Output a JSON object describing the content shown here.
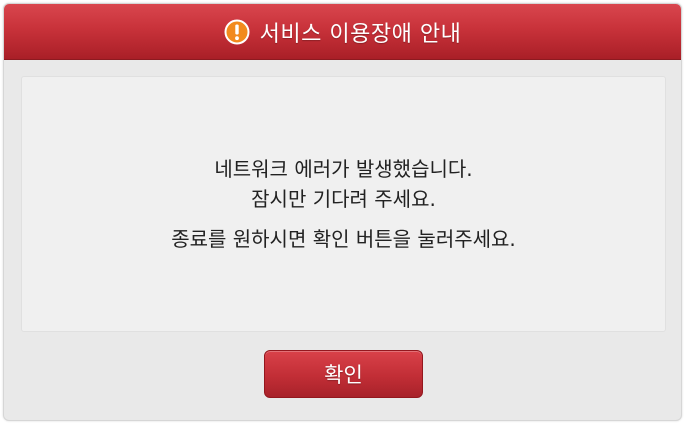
{
  "dialog": {
    "title": "서비스 이용장애 안내",
    "icon": "exclamation-circle-icon",
    "message": {
      "line1": "네트워크 에러가 발생했습니다.",
      "line2": "잠시만 기다려 주세요.",
      "line3": "종료를 원하시면 확인 버튼을 눌러주세요."
    },
    "confirm_label": "확인"
  },
  "colors": {
    "accent": "#c8323a",
    "icon_fill": "#f28a1e",
    "background": "#e9e9e9",
    "text": "#222222"
  }
}
